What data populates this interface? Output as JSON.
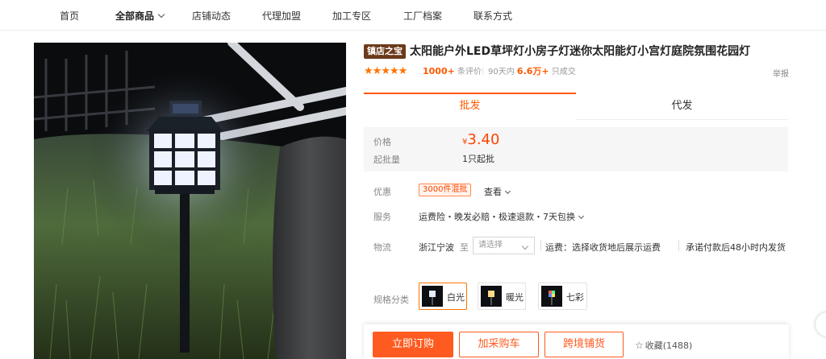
{
  "nav": {
    "items": [
      {
        "label": "首页"
      },
      {
        "label": "全部商品"
      },
      {
        "label": "店铺动态"
      },
      {
        "label": "代理加盟"
      },
      {
        "label": "加工专区"
      },
      {
        "label": "工厂档案"
      },
      {
        "label": "联系方式"
      }
    ]
  },
  "product": {
    "badge": "镇店之宝",
    "title": "太阳能户外LED草坪灯小房子灯迷你太阳能灯小宫灯庭院氛围花园灯",
    "rating_stars": 5,
    "review_count": "1000+",
    "review_suffix": "条评价",
    "sales_period": "90天内",
    "sales_count": "6.6万+",
    "sales_suffix": "只成交",
    "report": "举报"
  },
  "tabs": {
    "wholesale": "批发",
    "dropship": "代发"
  },
  "pricing": {
    "price_label": "价格",
    "currency": "¥",
    "price": "3.40",
    "moq_label": "起批量",
    "moq": "1只起批"
  },
  "details": {
    "promo_label": "优惠",
    "promo_tag": "3000件混批",
    "promo_view": "查看",
    "service_label": "服务",
    "service_value": "运费险・晚发必赔・极速退款・7天包换",
    "logistics_label": "物流",
    "origin": "浙江宁波",
    "to": "至",
    "dest_placeholder": "请选择",
    "freight": "运费：选择收货地后展示运费",
    "ship_promise": "承诺付款后48小时内发货"
  },
  "specs": {
    "label": "规格分类",
    "options": [
      {
        "label": "白光",
        "selected": true
      },
      {
        "label": "暖光",
        "selected": false
      },
      {
        "label": "七彩",
        "selected": false
      }
    ]
  },
  "actions": {
    "buy_now": "立即订购",
    "add_to_cart": "加采购车",
    "cross_border": "跨境铺货",
    "favorite": "收藏(1488)"
  },
  "colors": {
    "accent": "#ff5a1f",
    "price": "#ff4400",
    "badge": "#6b3a1b"
  }
}
